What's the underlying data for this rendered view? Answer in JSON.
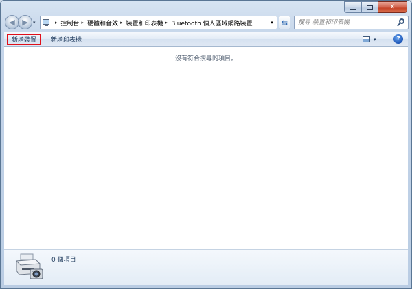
{
  "window": {
    "caption": {
      "minimize_label": "",
      "maximize_label": "",
      "close_label": "✕"
    }
  },
  "nav": {
    "back_glyph": "◀",
    "forward_glyph": "▶",
    "dropdown_glyph": "▾",
    "refresh_glyph": "⇆"
  },
  "address": {
    "breadcrumbs": [
      "控制台",
      "硬體和音效",
      "裝置和印表機",
      "Bluetooth 個人區域網路裝置"
    ],
    "separator": "▸",
    "dropdown_glyph": "▾"
  },
  "search": {
    "placeholder": "搜尋 裝置和印表機"
  },
  "toolbar": {
    "add_device_label": "新增裝置",
    "add_printer_label": "新增印表機",
    "view_caret": "▾",
    "help_label": "?"
  },
  "content": {
    "empty_message": "沒有符合搜尋的項目。"
  },
  "details": {
    "item_count": "0 個項目"
  },
  "colors": {
    "accent_highlight": "#e0101a",
    "frame": "#b9cce3",
    "close_button": "#c2391f"
  },
  "icons": {
    "computer": "computer-icon",
    "search": "search-icon",
    "help": "help-icon",
    "printer": "printer-camera-icon",
    "view": "view-options-icon"
  }
}
